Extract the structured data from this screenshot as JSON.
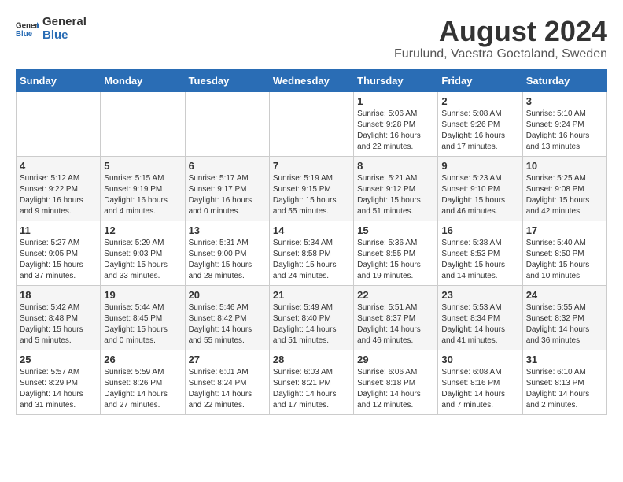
{
  "logo": {
    "general": "General",
    "blue": "Blue"
  },
  "title": "August 2024",
  "subtitle": "Furulund, Vaestra Goetaland, Sweden",
  "calendar": {
    "headers": [
      "Sunday",
      "Monday",
      "Tuesday",
      "Wednesday",
      "Thursday",
      "Friday",
      "Saturday"
    ],
    "weeks": [
      [
        {
          "day": "",
          "info": ""
        },
        {
          "day": "",
          "info": ""
        },
        {
          "day": "",
          "info": ""
        },
        {
          "day": "",
          "info": ""
        },
        {
          "day": "1",
          "info": "Sunrise: 5:06 AM\nSunset: 9:28 PM\nDaylight: 16 hours\nand 22 minutes."
        },
        {
          "day": "2",
          "info": "Sunrise: 5:08 AM\nSunset: 9:26 PM\nDaylight: 16 hours\nand 17 minutes."
        },
        {
          "day": "3",
          "info": "Sunrise: 5:10 AM\nSunset: 9:24 PM\nDaylight: 16 hours\nand 13 minutes."
        }
      ],
      [
        {
          "day": "4",
          "info": "Sunrise: 5:12 AM\nSunset: 9:22 PM\nDaylight: 16 hours\nand 9 minutes."
        },
        {
          "day": "5",
          "info": "Sunrise: 5:15 AM\nSunset: 9:19 PM\nDaylight: 16 hours\nand 4 minutes."
        },
        {
          "day": "6",
          "info": "Sunrise: 5:17 AM\nSunset: 9:17 PM\nDaylight: 16 hours\nand 0 minutes."
        },
        {
          "day": "7",
          "info": "Sunrise: 5:19 AM\nSunset: 9:15 PM\nDaylight: 15 hours\nand 55 minutes."
        },
        {
          "day": "8",
          "info": "Sunrise: 5:21 AM\nSunset: 9:12 PM\nDaylight: 15 hours\nand 51 minutes."
        },
        {
          "day": "9",
          "info": "Sunrise: 5:23 AM\nSunset: 9:10 PM\nDaylight: 15 hours\nand 46 minutes."
        },
        {
          "day": "10",
          "info": "Sunrise: 5:25 AM\nSunset: 9:08 PM\nDaylight: 15 hours\nand 42 minutes."
        }
      ],
      [
        {
          "day": "11",
          "info": "Sunrise: 5:27 AM\nSunset: 9:05 PM\nDaylight: 15 hours\nand 37 minutes."
        },
        {
          "day": "12",
          "info": "Sunrise: 5:29 AM\nSunset: 9:03 PM\nDaylight: 15 hours\nand 33 minutes."
        },
        {
          "day": "13",
          "info": "Sunrise: 5:31 AM\nSunset: 9:00 PM\nDaylight: 15 hours\nand 28 minutes."
        },
        {
          "day": "14",
          "info": "Sunrise: 5:34 AM\nSunset: 8:58 PM\nDaylight: 15 hours\nand 24 minutes."
        },
        {
          "day": "15",
          "info": "Sunrise: 5:36 AM\nSunset: 8:55 PM\nDaylight: 15 hours\nand 19 minutes."
        },
        {
          "day": "16",
          "info": "Sunrise: 5:38 AM\nSunset: 8:53 PM\nDaylight: 15 hours\nand 14 minutes."
        },
        {
          "day": "17",
          "info": "Sunrise: 5:40 AM\nSunset: 8:50 PM\nDaylight: 15 hours\nand 10 minutes."
        }
      ],
      [
        {
          "day": "18",
          "info": "Sunrise: 5:42 AM\nSunset: 8:48 PM\nDaylight: 15 hours\nand 5 minutes."
        },
        {
          "day": "19",
          "info": "Sunrise: 5:44 AM\nSunset: 8:45 PM\nDaylight: 15 hours\nand 0 minutes."
        },
        {
          "day": "20",
          "info": "Sunrise: 5:46 AM\nSunset: 8:42 PM\nDaylight: 14 hours\nand 55 minutes."
        },
        {
          "day": "21",
          "info": "Sunrise: 5:49 AM\nSunset: 8:40 PM\nDaylight: 14 hours\nand 51 minutes."
        },
        {
          "day": "22",
          "info": "Sunrise: 5:51 AM\nSunset: 8:37 PM\nDaylight: 14 hours\nand 46 minutes."
        },
        {
          "day": "23",
          "info": "Sunrise: 5:53 AM\nSunset: 8:34 PM\nDaylight: 14 hours\nand 41 minutes."
        },
        {
          "day": "24",
          "info": "Sunrise: 5:55 AM\nSunset: 8:32 PM\nDaylight: 14 hours\nand 36 minutes."
        }
      ],
      [
        {
          "day": "25",
          "info": "Sunrise: 5:57 AM\nSunset: 8:29 PM\nDaylight: 14 hours\nand 31 minutes."
        },
        {
          "day": "26",
          "info": "Sunrise: 5:59 AM\nSunset: 8:26 PM\nDaylight: 14 hours\nand 27 minutes."
        },
        {
          "day": "27",
          "info": "Sunrise: 6:01 AM\nSunset: 8:24 PM\nDaylight: 14 hours\nand 22 minutes."
        },
        {
          "day": "28",
          "info": "Sunrise: 6:03 AM\nSunset: 8:21 PM\nDaylight: 14 hours\nand 17 minutes."
        },
        {
          "day": "29",
          "info": "Sunrise: 6:06 AM\nSunset: 8:18 PM\nDaylight: 14 hours\nand 12 minutes."
        },
        {
          "day": "30",
          "info": "Sunrise: 6:08 AM\nSunset: 8:16 PM\nDaylight: 14 hours\nand 7 minutes."
        },
        {
          "day": "31",
          "info": "Sunrise: 6:10 AM\nSunset: 8:13 PM\nDaylight: 14 hours\nand 2 minutes."
        }
      ]
    ]
  }
}
